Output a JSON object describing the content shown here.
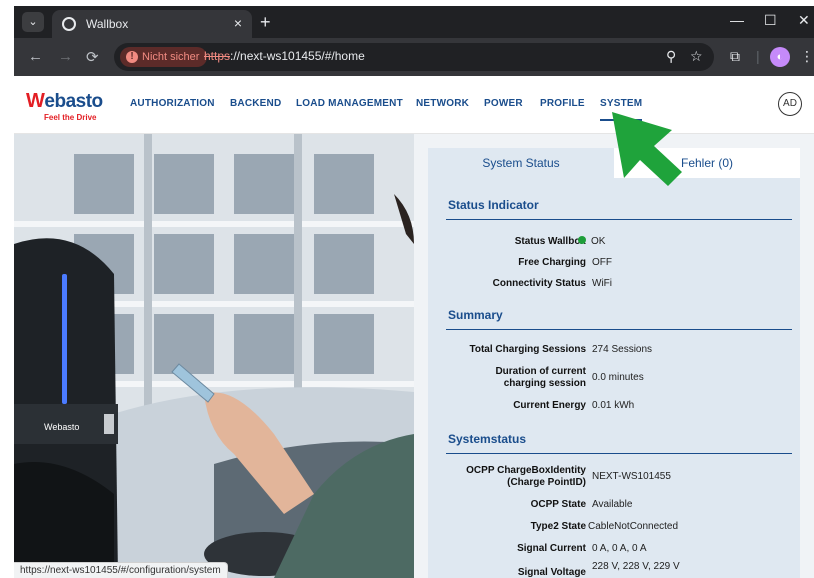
{
  "browser": {
    "tab_title": "Wallbox",
    "insecure_label": "Nicht sicher",
    "url_scheme": "https",
    "url_rest": "://next-ws101455/#/home",
    "status_url": "https://next-ws101455/#/configuration/system"
  },
  "header": {
    "logo_text": "ebasto",
    "logo_mark": "W",
    "tagline": "Feel the Drive",
    "nav": [
      {
        "label": "AUTHORIZATION"
      },
      {
        "label": "BACKEND"
      },
      {
        "label": "LOAD MANAGEMENT"
      },
      {
        "label": "NETWORK"
      },
      {
        "label": "POWER"
      },
      {
        "label": "PROFILE"
      },
      {
        "label": "SYSTEM"
      }
    ],
    "user_initials": "AD"
  },
  "tabs": {
    "status": "System Status",
    "errors": "Fehler (0)"
  },
  "sections": {
    "status_indicator": {
      "title": "Status Indicator",
      "rows": [
        {
          "label": "Status Wallbox",
          "value": "OK"
        },
        {
          "label": "Free Charging",
          "value": "OFF"
        },
        {
          "label": "Connectivity Status",
          "value": "WiFi"
        }
      ]
    },
    "summary": {
      "title": "Summary",
      "rows": [
        {
          "label": "Total Charging Sessions",
          "value": "274 Sessions"
        },
        {
          "label": "Duration of current charging session",
          "value": "0.0 minutes"
        },
        {
          "label": "Current Energy",
          "value": "0.01 kWh"
        }
      ]
    },
    "systemstatus": {
      "title": "Systemstatus",
      "rows": [
        {
          "label": "OCPP ChargeBoxIdentity (Charge PointID)",
          "value": "NEXT-WS101455"
        },
        {
          "label": "OCPP State",
          "value": "Available"
        },
        {
          "label": "Type2 State",
          "value": "CableNotConnected"
        },
        {
          "label": "Signal Current",
          "value": "0 A, 0 A, 0 A"
        },
        {
          "label": "Signal Voltage",
          "value": "228 V, 228 V, 229 V"
        }
      ]
    }
  },
  "colors": {
    "brand_blue": "#1a4d8c",
    "brand_red": "#e31e24",
    "ok_green": "#1e9e3a",
    "pointer_arrow": "#1fa33b"
  }
}
